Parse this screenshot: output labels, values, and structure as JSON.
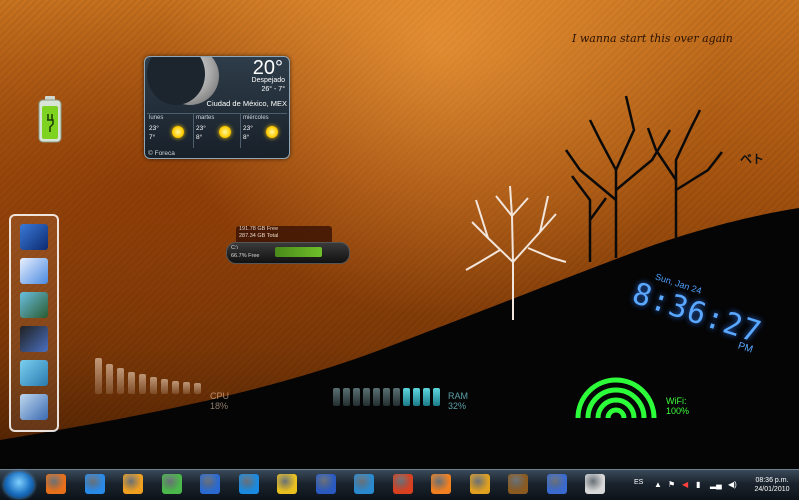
{
  "wallpaper": {
    "quote": "I wanna start this over again",
    "kana": "ベト"
  },
  "weather": {
    "temperature": "20°",
    "condition": "Despejado",
    "range": "26° - 7°",
    "city": "Ciudad de México, MEX",
    "credit": "© Foreca",
    "forecast": [
      {
        "day": "lunes",
        "high": "23°",
        "low": "7°"
      },
      {
        "day": "martes",
        "high": "23°",
        "low": "8°"
      },
      {
        "day": "miércoles",
        "high": "23°",
        "low": "8°"
      }
    ]
  },
  "drive": {
    "free": "191.78 GB Free",
    "total": "287.34 GB Total",
    "letter": "C:\\",
    "percent_free": "66.7% Free",
    "fill_fraction": 0.667
  },
  "cpu": {
    "label": "CPU",
    "value": "18%"
  },
  "ram": {
    "label": "RAM",
    "value": "32%"
  },
  "wifi": {
    "label": "WiFi:",
    "value": "100%"
  },
  "clock": {
    "date": "Sun, Jan 24",
    "time": "8:36:27",
    "ampm": "PM"
  },
  "taskbar": {
    "icons": [
      "firefox-icon",
      "internet-explorer-icon",
      "media-player-icon",
      "messenger-icon",
      "weather-app-icon",
      "avast-icon",
      "pidgin-icon",
      "word-icon",
      "publisher-icon",
      "powerpoint-icon",
      "gimp-icon",
      "winamp-icon",
      "game-icon",
      "jdownloader-icon",
      "itunes-icon"
    ],
    "language": "ES",
    "time": "08:36 p.m.",
    "date": "24/01/2010"
  },
  "dock": {
    "icons": [
      "computer-icon",
      "documents-icon",
      "pictures-icon",
      "games-icon",
      "control-panel-icon",
      "network-icon"
    ]
  }
}
